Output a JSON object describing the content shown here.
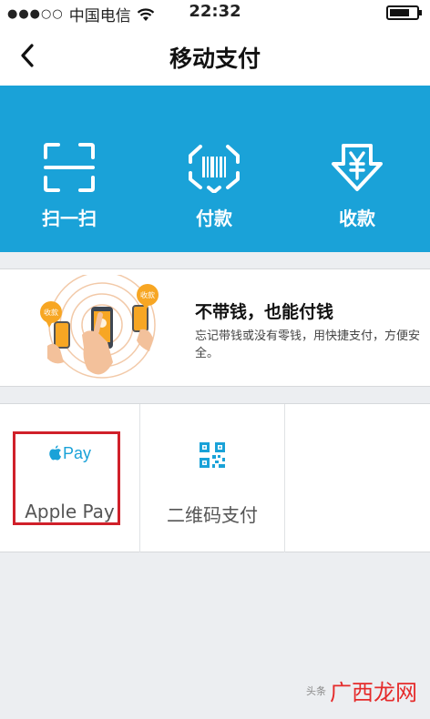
{
  "status_bar": {
    "signal": "●●●○○",
    "carrier": "中国电信",
    "time": "22:32",
    "battery_level": 0.75
  },
  "nav": {
    "title": "移动支付"
  },
  "banner": {
    "background": "#1aa2d8",
    "items": [
      {
        "label": "扫一扫",
        "icon": "scan-icon"
      },
      {
        "label": "付款",
        "icon": "barcode-pay-icon"
      },
      {
        "label": "收款",
        "icon": "yen-receive-icon"
      }
    ]
  },
  "promo": {
    "headline": "不带钱，也能付钱",
    "description": "忘记带钱或没有零钱，用快捷支付，方便安全。",
    "bubble_text": "收款"
  },
  "methods": {
    "items": [
      {
        "label": "Apple Pay",
        "mark": "Pay",
        "icon": "apple-pay-icon"
      },
      {
        "label": "二维码支付",
        "icon": "qr-code-icon"
      }
    ],
    "highlight_color": "#d0202a"
  },
  "watermark": {
    "text": "广西龙网",
    "mark": "头条"
  }
}
